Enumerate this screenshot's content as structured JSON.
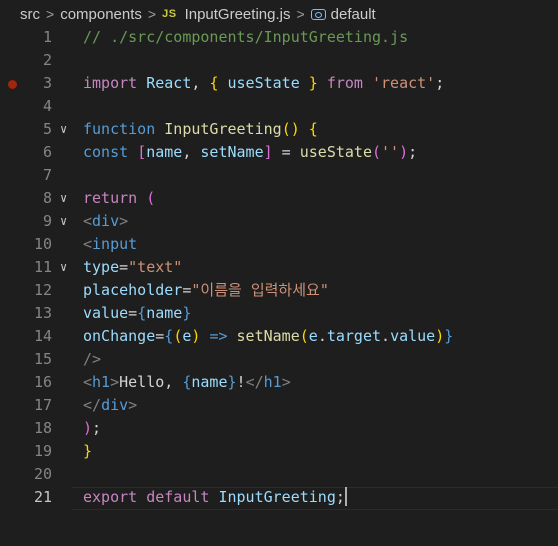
{
  "breadcrumb": {
    "items": [
      "src",
      "components",
      "InputGreeting.js",
      "default"
    ],
    "file_badge": "JS"
  },
  "editor": {
    "active_line": 21,
    "lines": [
      {
        "n": "1",
        "fold": false,
        "breakpoint": false,
        "tokens": [
          [
            "// ./src/components/InputGreeting.js",
            "com"
          ]
        ]
      },
      {
        "n": "2",
        "fold": false,
        "breakpoint": false,
        "tokens": []
      },
      {
        "n": "3",
        "fold": false,
        "breakpoint": true,
        "tokens": [
          [
            "import",
            "ctl"
          ],
          [
            " ",
            "txt"
          ],
          [
            "React",
            "var"
          ],
          [
            ", ",
            "txt"
          ],
          [
            "{",
            "y"
          ],
          [
            " ",
            "txt"
          ],
          [
            "useState",
            "var"
          ],
          [
            " ",
            "txt"
          ],
          [
            "}",
            "y"
          ],
          [
            " ",
            "txt"
          ],
          [
            "from",
            "ctl"
          ],
          [
            " ",
            "txt"
          ],
          [
            "'react'",
            "str"
          ],
          [
            ";",
            "txt"
          ]
        ]
      },
      {
        "n": "4",
        "fold": false,
        "breakpoint": false,
        "tokens": []
      },
      {
        "n": "5",
        "fold": true,
        "breakpoint": false,
        "tokens": [
          [
            "function",
            "kw"
          ],
          [
            " ",
            "txt"
          ],
          [
            "InputGreeting",
            "fn"
          ],
          [
            "()",
            "y"
          ],
          [
            " ",
            "txt"
          ],
          [
            "{",
            "y"
          ]
        ]
      },
      {
        "n": "6",
        "fold": false,
        "breakpoint": false,
        "tokens": [
          [
            "const",
            "kw"
          ],
          [
            " ",
            "txt"
          ],
          [
            "[",
            "p"
          ],
          [
            "name",
            "var"
          ],
          [
            ", ",
            "txt"
          ],
          [
            "setName",
            "var"
          ],
          [
            "]",
            "p"
          ],
          [
            " = ",
            "txt"
          ],
          [
            "useState",
            "fn"
          ],
          [
            "(",
            "p"
          ],
          [
            "''",
            "str"
          ],
          [
            ")",
            "p"
          ],
          [
            ";",
            "txt"
          ]
        ]
      },
      {
        "n": "7",
        "fold": false,
        "breakpoint": false,
        "tokens": []
      },
      {
        "n": "8",
        "fold": true,
        "breakpoint": false,
        "tokens": [
          [
            "return",
            "ctl"
          ],
          [
            " ",
            "txt"
          ],
          [
            "(",
            "p"
          ]
        ]
      },
      {
        "n": "9",
        "fold": true,
        "breakpoint": false,
        "tokens": [
          [
            "<",
            "gray"
          ],
          [
            "div",
            "tag"
          ],
          [
            ">",
            "gray"
          ]
        ]
      },
      {
        "n": "10",
        "fold": false,
        "breakpoint": false,
        "tokens": [
          [
            "<",
            "gray"
          ],
          [
            "input",
            "tag"
          ]
        ]
      },
      {
        "n": "11",
        "fold": true,
        "breakpoint": false,
        "tokens": [
          [
            "type",
            "var"
          ],
          [
            "=",
            "txt"
          ],
          [
            "\"text\"",
            "str"
          ]
        ]
      },
      {
        "n": "12",
        "fold": false,
        "breakpoint": false,
        "tokens": [
          [
            "placeholder",
            "var"
          ],
          [
            "=",
            "txt"
          ],
          [
            "\"이름을 입력하세요\"",
            "str"
          ]
        ]
      },
      {
        "n": "13",
        "fold": false,
        "breakpoint": false,
        "tokens": [
          [
            "value",
            "var"
          ],
          [
            "=",
            "txt"
          ],
          [
            "{",
            "kw"
          ],
          [
            "name",
            "var"
          ],
          [
            "}",
            "kw"
          ]
        ]
      },
      {
        "n": "14",
        "fold": false,
        "breakpoint": false,
        "tokens": [
          [
            "onChange",
            "var"
          ],
          [
            "=",
            "txt"
          ],
          [
            "{",
            "kw"
          ],
          [
            "(",
            "y"
          ],
          [
            "e",
            "var"
          ],
          [
            ")",
            "y"
          ],
          [
            " ",
            "txt"
          ],
          [
            "=>",
            "kw"
          ],
          [
            " ",
            "txt"
          ],
          [
            "setName",
            "fn"
          ],
          [
            "(",
            "y"
          ],
          [
            "e",
            "var"
          ],
          [
            ".",
            "txt"
          ],
          [
            "target",
            "var"
          ],
          [
            ".",
            "txt"
          ],
          [
            "value",
            "var"
          ],
          [
            ")",
            "y"
          ],
          [
            "}",
            "kw"
          ]
        ]
      },
      {
        "n": "15",
        "fold": false,
        "breakpoint": false,
        "tokens": [
          [
            "/>",
            "gray"
          ]
        ]
      },
      {
        "n": "16",
        "fold": false,
        "breakpoint": false,
        "tokens": [
          [
            "<",
            "gray"
          ],
          [
            "h1",
            "tag"
          ],
          [
            ">",
            "gray"
          ],
          [
            "Hello, ",
            "txt"
          ],
          [
            "{",
            "kw"
          ],
          [
            "name",
            "var"
          ],
          [
            "}",
            "kw"
          ],
          [
            "!",
            "txt"
          ],
          [
            "</",
            "gray"
          ],
          [
            "h1",
            "tag"
          ],
          [
            ">",
            "gray"
          ]
        ]
      },
      {
        "n": "17",
        "fold": false,
        "breakpoint": false,
        "tokens": [
          [
            "</",
            "gray"
          ],
          [
            "div",
            "tag"
          ],
          [
            ">",
            "gray"
          ]
        ]
      },
      {
        "n": "18",
        "fold": false,
        "breakpoint": false,
        "tokens": [
          [
            ")",
            "p"
          ],
          [
            ";",
            "txt"
          ]
        ]
      },
      {
        "n": "19",
        "fold": false,
        "breakpoint": false,
        "tokens": [
          [
            "}",
            "y"
          ]
        ]
      },
      {
        "n": "20",
        "fold": false,
        "breakpoint": false,
        "tokens": []
      },
      {
        "n": "21",
        "fold": false,
        "breakpoint": false,
        "tokens": [
          [
            "export",
            "ctl"
          ],
          [
            " ",
            "txt"
          ],
          [
            "default",
            "ctl"
          ],
          [
            " ",
            "txt"
          ],
          [
            "InputGreeting",
            "var"
          ],
          [
            ";",
            "txt"
          ]
        ]
      }
    ]
  },
  "colors": {
    "background": "#1e1e1e",
    "line_number": "#858585",
    "breakpoint": "#a1260d"
  }
}
